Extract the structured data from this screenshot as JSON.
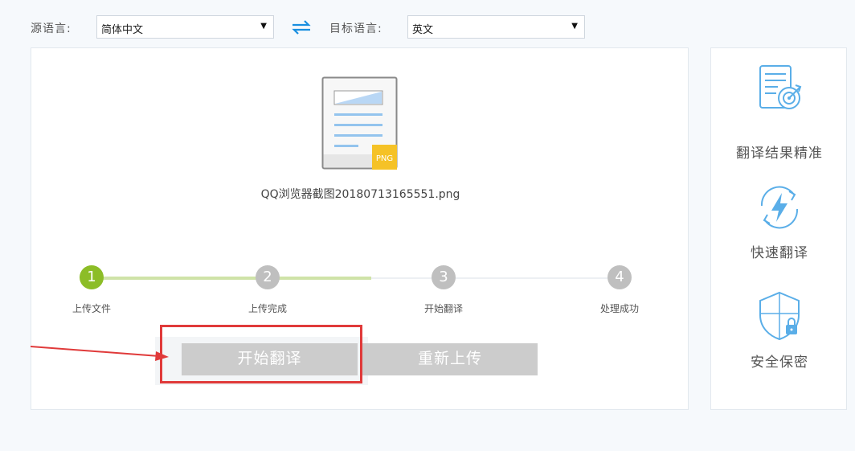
{
  "lang_bar": {
    "source_label": "源语言:",
    "source_value": "简体中文",
    "target_label": "目标语言:",
    "target_value": "英文",
    "swap_icon": "swap-arrows-icon"
  },
  "upload": {
    "file_type_badge": "PNG",
    "file_name": "QQ浏览器截图20180713165551.png"
  },
  "steps": [
    {
      "number": "1",
      "label": "上传文件",
      "state": "active"
    },
    {
      "number": "2",
      "label": "上传完成",
      "state": "inactive"
    },
    {
      "number": "3",
      "label": "开始翻译",
      "state": "inactive"
    },
    {
      "number": "4",
      "label": "处理成功",
      "state": "inactive"
    }
  ],
  "progress": {
    "completed_segment_fraction": 0.5
  },
  "actions": {
    "start_label": "开始翻译",
    "reupload_label": "重新上传"
  },
  "features": [
    {
      "icon": "document-target-icon",
      "label": "翻译结果精准"
    },
    {
      "icon": "lightning-refresh-icon",
      "label": "快速翻译"
    },
    {
      "icon": "shield-lock-icon",
      "label": "安全保密"
    }
  ],
  "colors": {
    "accent_blue": "#1a8fe0",
    "step_active": "#8cbd27",
    "step_inactive": "#bfbfbf",
    "button_disabled": "#cccccc",
    "annotation_red": "#e03a3a",
    "icon_blue": "#5aaee8"
  }
}
